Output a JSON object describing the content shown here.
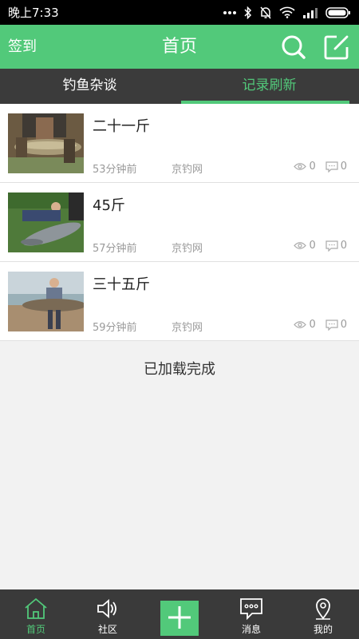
{
  "status": {
    "time": "晚上7:33"
  },
  "header": {
    "signin": "签到",
    "title": "首页"
  },
  "tabs": [
    {
      "label": "钓鱼杂谈",
      "active": false
    },
    {
      "label": "记录刷新",
      "active": true
    }
  ],
  "posts": [
    {
      "title": "二十一斤",
      "time": "53分钟前",
      "source": "京钓网",
      "views": "0",
      "comments": "0"
    },
    {
      "title": "45斤",
      "time": "57分钟前",
      "source": "京钓网",
      "views": "0",
      "comments": "0"
    },
    {
      "title": "三十五斤",
      "time": "59分钟前",
      "source": "京钓网",
      "views": "0",
      "comments": "0"
    }
  ],
  "load_done": "已加载完成",
  "nav": [
    {
      "label": "首页",
      "icon": "home-icon"
    },
    {
      "label": "社区",
      "icon": "community-speaker-icon"
    },
    {
      "label": "",
      "icon": "plus-icon"
    },
    {
      "label": "消息",
      "icon": "message-icon"
    },
    {
      "label": "我的",
      "icon": "location-pin-icon"
    }
  ],
  "colors": {
    "accent": "#52c97a",
    "dark": "#3b3b3b"
  }
}
